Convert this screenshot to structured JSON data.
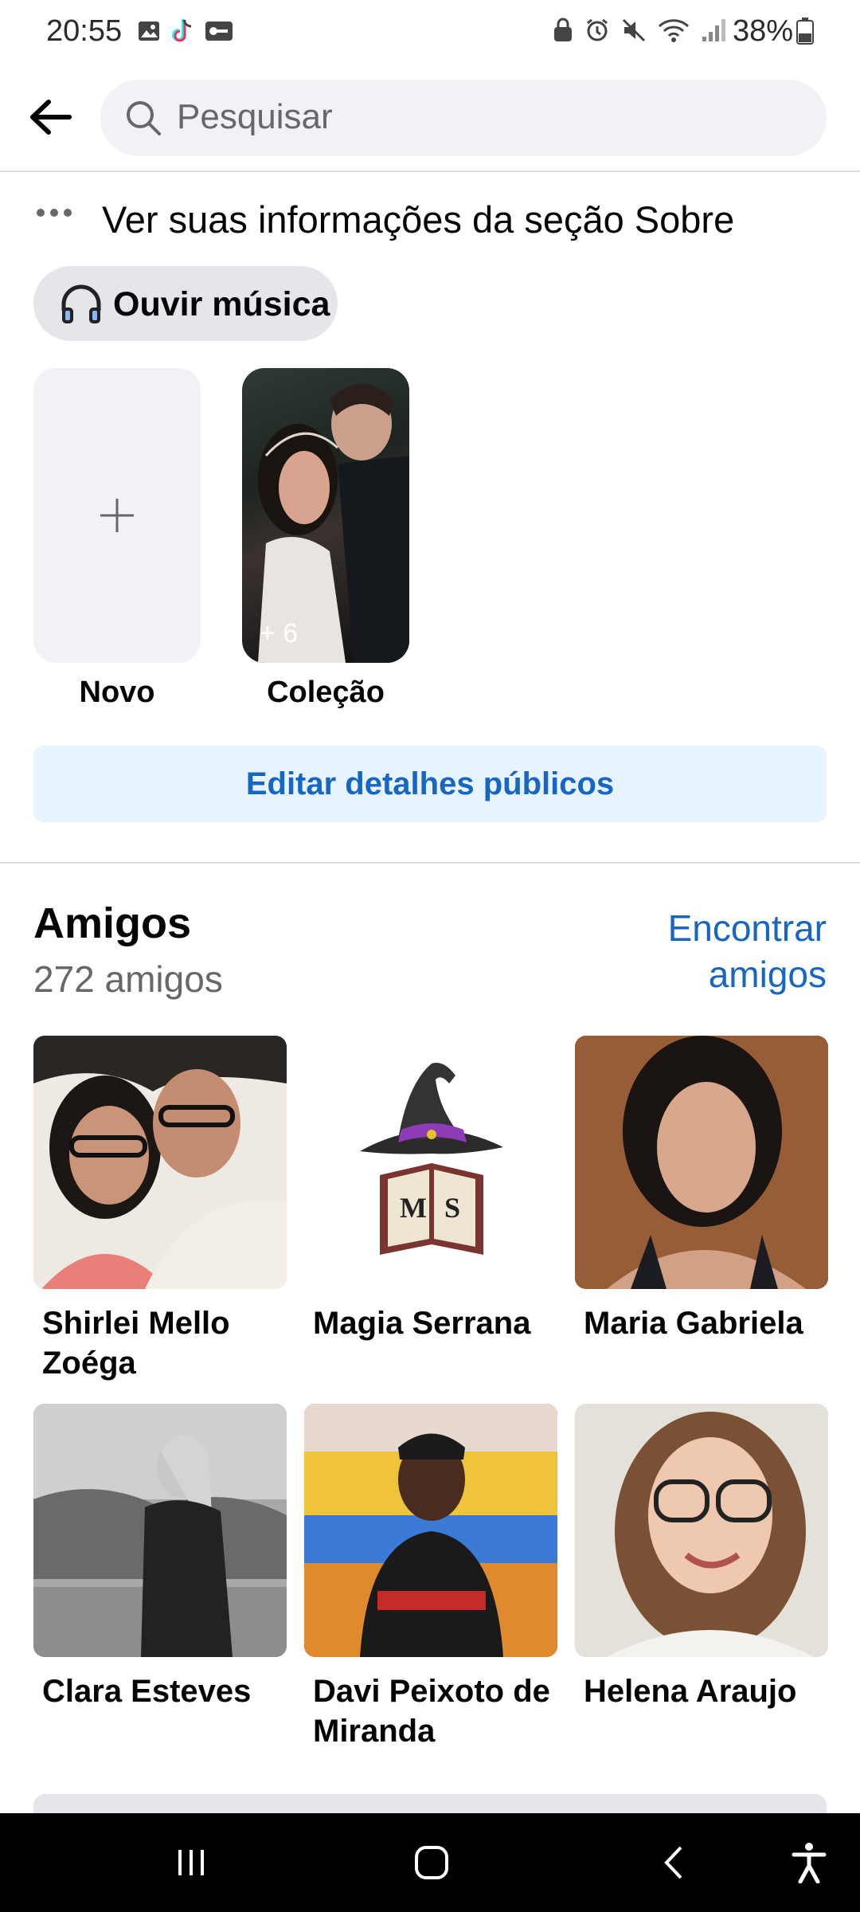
{
  "status_bar": {
    "time": "20:55",
    "battery": "38%"
  },
  "search": {
    "placeholder": "Pesquisar"
  },
  "about": {
    "text": "Ver suas informações da seção Sobre"
  },
  "music": {
    "label": "Ouvir música"
  },
  "featured": {
    "new_label": "Novo",
    "collection_label": "Coleção",
    "collection_count": "+ 6"
  },
  "edit_button": {
    "label": "Editar detalhes públicos"
  },
  "friends": {
    "title": "Amigos",
    "count": "272 amigos",
    "find_link": "Encontrar amigos",
    "items": [
      {
        "name": "Shirlei Mello Zoéga"
      },
      {
        "name": "Magia Serrana"
      },
      {
        "name": "Maria Gabriela"
      },
      {
        "name": "Clara Esteves"
      },
      {
        "name": "Davi Peixoto de Miranda"
      },
      {
        "name": "Helena Araujo"
      }
    ]
  },
  "colors": {
    "accent": "#1766c2",
    "chip_bg": "#e4e6eb",
    "button_bg": "#e7f3ff"
  }
}
